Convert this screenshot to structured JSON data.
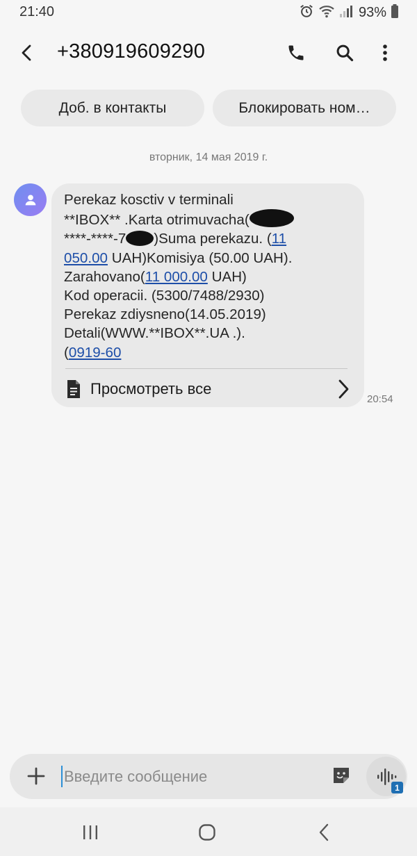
{
  "status_bar": {
    "time": "21:40",
    "battery": "93%"
  },
  "header": {
    "contact": "+380919609290",
    "icons": [
      "back-arrow-icon",
      "phone-icon",
      "search-icon",
      "more-vertical-icon"
    ]
  },
  "chips": {
    "add_contact": "Доб. в контакты",
    "block_number": "Блокировать ном…"
  },
  "conversation": {
    "date": "вторник, 14 мая 2019 г.",
    "message": {
      "line1": "Perekaz kosctiv v terminali",
      "line2": "**IBOX** .Karta otrimuvacha(",
      "line3a": "****-****-7",
      "line3b": ")Suma perekazu.   (",
      "link_sum_a": "11",
      "link_sum_b": "050.00",
      "line4": " UAH)Komisiya (50.00 UAH).",
      "line5a": "Zarahovano(",
      "link_credited": "11 000.00",
      "line5b": " UAH)",
      "line6": "Kod operacii. (5300/7488/2930)",
      "line7": "Perekaz zdiysneno(14.05.2019)",
      "line8": "Detali(WWW.**IBOX**.UA .).",
      "line9a": "(",
      "link_phone": "0919-60",
      "view_all": "Просмотреть все",
      "time": "20:54"
    }
  },
  "composer": {
    "placeholder": "Введите сообщение",
    "voice_badge": "1"
  },
  "colors": {
    "background": "#f6f6f6",
    "bubble": "#e9e9e9",
    "link": "#1d4ea8",
    "caret": "#2c8fd6",
    "badge": "#1f6fb3"
  }
}
